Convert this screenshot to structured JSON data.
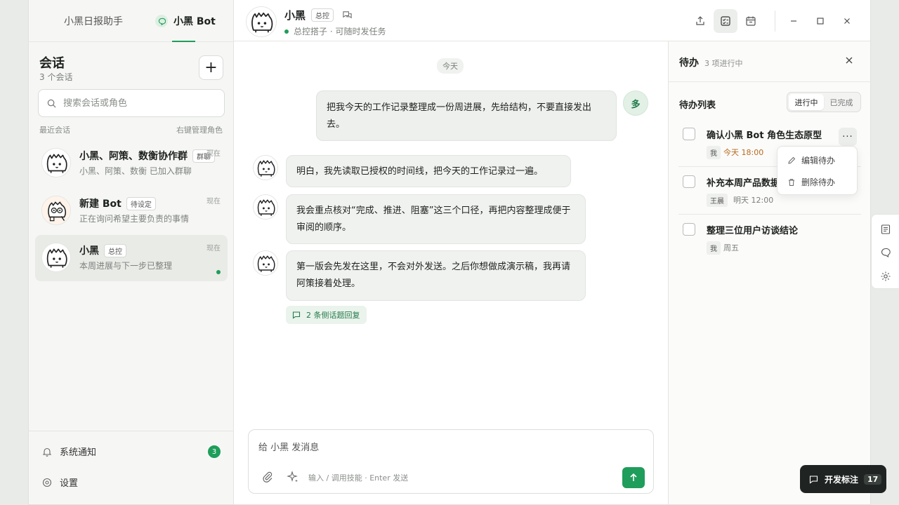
{
  "app_tabs": {
    "assistant": "小黑日报助手",
    "bot": "小黑 Bot"
  },
  "sidebar": {
    "title": "会话",
    "count": "3 个会话",
    "add_label": "+",
    "search_placeholder": "搜索会话或角色",
    "recent_label": "最近会话",
    "manage_hint": "右键管理角色",
    "conversations": [
      {
        "name": "小黑、阿策、数衡协作群",
        "badge": "群聊",
        "preview": "小黑、阿策、数衡 已加入群聊",
        "time": "现在"
      },
      {
        "name": "新建 Bot",
        "badge": "待设定",
        "preview": "正在询问希望主要负责的事情",
        "time": "现在"
      },
      {
        "name": "小黑",
        "badge": "总控",
        "preview": "本周进展与下一步已整理",
        "time": "现在"
      }
    ],
    "bottom": {
      "notifications": "系统通知",
      "notif_count": "3",
      "settings": "设置"
    }
  },
  "chat": {
    "name": "小黑",
    "badge": "总控",
    "status": "总控搭子 · 可随时发任务",
    "date_chip": "今天",
    "user_avatar": "多",
    "messages": [
      {
        "from": "user",
        "text": "把我今天的工作记录整理成一份周进展，先给结构，不要直接发出去。"
      },
      {
        "from": "bot",
        "text": "明白，我先读取已授权的时间线，把今天的工作记录过一遍。"
      },
      {
        "from": "bot",
        "text": "我会重点核对“完成、推进、阻塞”这三个口径，再把内容整理成便于审阅的顺序。"
      },
      {
        "from": "bot",
        "text": "第一版会先发在这里，不会对外发送。之后你想做成演示稿，我再请阿策接着处理。"
      }
    ],
    "thread_reply": "2 条侧话题回复",
    "composer": {
      "placeholder": "给 小黑 发消息",
      "hint": "输入 / 调用技能 · Enter 发送"
    }
  },
  "todo_panel": {
    "title": "待办",
    "count": "3 项进行中",
    "list_title": "待办列表",
    "tabs": [
      "进行中",
      "已完成"
    ],
    "active_tab": 0,
    "items": [
      {
        "title": "确认小黑 Bot 角色生态原型",
        "owner": "我",
        "due": "今天 18:00",
        "urgent": true
      },
      {
        "title": "补充本周产品数据",
        "owner": "王晨",
        "due": "明天 12:00",
        "urgent": false
      },
      {
        "title": "整理三位用户访谈结论",
        "owner": "我",
        "due": "周五",
        "urgent": false
      }
    ],
    "menu": {
      "edit": "编辑待办",
      "delete": "删除待办"
    },
    "more_label": "···"
  },
  "dev_button": {
    "label": "开发标注",
    "count": "17"
  },
  "colors": {
    "accent": "#1f9d5a",
    "urgent": "#b86a1c"
  }
}
